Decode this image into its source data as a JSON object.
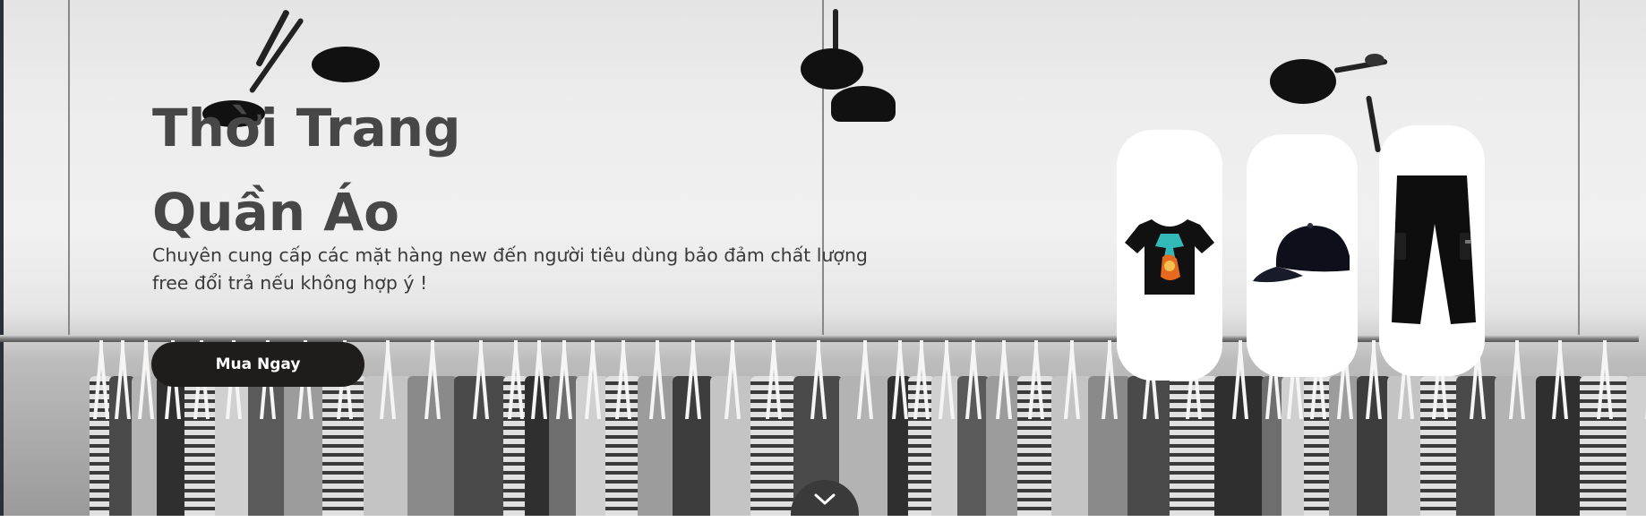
{
  "hero": {
    "title_line1": "Thời Trang",
    "title_line2": "Quần Áo",
    "subtitle": "Chuyên cung cấp các mặt hàng new đến người tiêu dùng bảo đảm chất lượng free đổi trả nếu không hợp ý !",
    "cta_label": "Mua Ngay"
  },
  "products": [
    {
      "name": "tshirt",
      "icon": "tshirt-icon"
    },
    {
      "name": "cap",
      "icon": "cap-icon"
    },
    {
      "name": "pants",
      "icon": "pants-icon"
    }
  ],
  "scroll_icon": "chevron-down-icon",
  "colors": {
    "button_bg": "#1f1c1c",
    "title": "#474747",
    "card_bg": "#ffffff"
  }
}
